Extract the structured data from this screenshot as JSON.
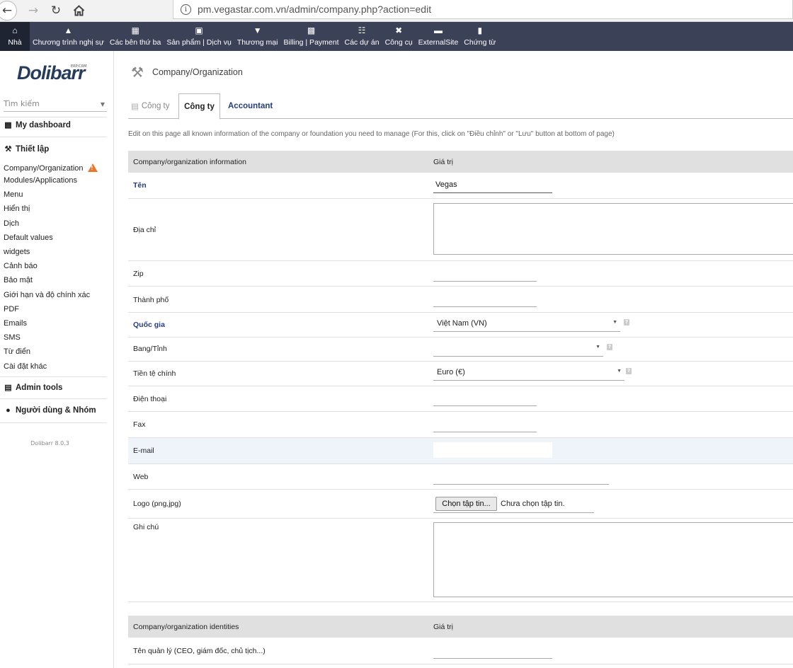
{
  "browser": {
    "url": "pm.vegastar.com.vn/admin/company.php?action=edit"
  },
  "topmenu": {
    "items": [
      {
        "label": "Nhà",
        "icon": "home-icon"
      },
      {
        "label": "Chương trình nghị sự",
        "icon": "agenda-icon"
      },
      {
        "label": "Các bên thứ ba",
        "icon": "building-icon"
      },
      {
        "label": "Sản phẩm | Dịch vụ",
        "icon": "cubes-icon"
      },
      {
        "label": "Thương mại",
        "icon": "tie-icon"
      },
      {
        "label": "Billing | Payment",
        "icon": "money-icon"
      },
      {
        "label": "Các dự án",
        "icon": "sitemap-icon"
      },
      {
        "label": "Công cụ",
        "icon": "tools-icon"
      },
      {
        "label": "ExternalSite",
        "icon": "external-icon"
      },
      {
        "label": "Chứng từ",
        "icon": "book-icon"
      }
    ]
  },
  "leftpanel": {
    "logo_text": "Dolibarr",
    "logo_sub": "ERP/CRM",
    "search_placeholder": "Tìm kiếm",
    "dashboard": "My dashboard",
    "setup": "Thiết lập",
    "setup_items": [
      "Company/Organization",
      "Modules/Applications",
      "Menu",
      "Hiển thị",
      "Dịch",
      "Default values",
      "widgets",
      "Cảnh báo",
      "Bảo mật",
      "Giới hạn và độ chính xác",
      "PDF",
      "Emails",
      "SMS",
      "Từ điển",
      "Cài đặt khác"
    ],
    "admin_tools": "Admin tools",
    "users_groups": "Người dùng & Nhóm",
    "version": "Dolibarr 8.0.3"
  },
  "main": {
    "title": "Company/Organization",
    "tabs": [
      "Công ty",
      "Công ty",
      "Accountant"
    ],
    "description": "Edit on this page all known information of the company or foundation you need to manage (For this, click on \"Điều chỉnh\" or \"Lưu\" button at bottom of page)",
    "info_table": {
      "col1": "Company/organization information",
      "col2": "Giá trị",
      "rows": {
        "name_label": "Tên",
        "name_value": "Vegas",
        "address_label": "Địa chỉ",
        "zip_label": "Zip",
        "city_label": "Thành phố",
        "country_label": "Quốc gia",
        "country_value": "Việt Nam (VN)",
        "state_label": "Bang/Tỉnh",
        "state_value": "",
        "currency_label": "Tiền tệ chính",
        "currency_value": "Euro (€)",
        "phone_label": "Điện thoại",
        "fax_label": "Fax",
        "email_label": "E-mail",
        "web_label": "Web",
        "logo_label": "Logo (png,jpg)",
        "file_button": "Chọn tập tin...",
        "file_status": "Chưa chọn tập tin.",
        "note_label": "Ghi chú"
      }
    },
    "identities_table": {
      "col1": "Company/organization identities",
      "col2": "Giá trị",
      "manager_label": "Tên quản lý (CEO, giám đốc, chủ tịch...)"
    },
    "help_glyph": "?"
  }
}
